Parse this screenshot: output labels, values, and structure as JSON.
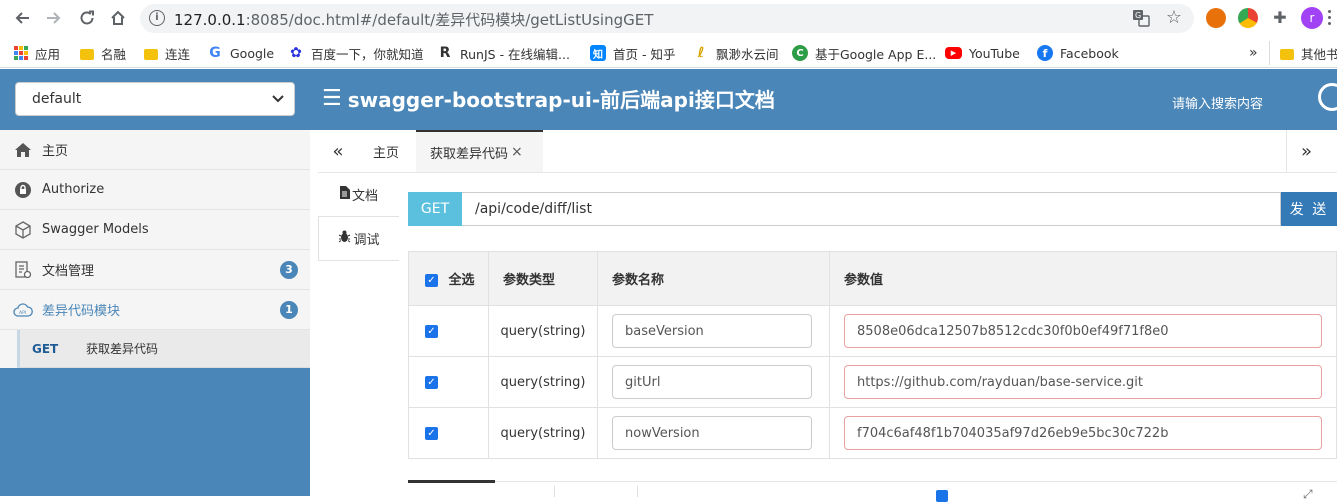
{
  "browser": {
    "url_host": "127.0.0.1",
    "url_rest": ":8085/doc.html#/default/差异代码模块/getListUsingGET",
    "avatar_letter": "r",
    "bookmarks": [
      {
        "label": "应用",
        "icon": "apps-icon"
      },
      {
        "label": "名融",
        "icon": "folder-icon"
      },
      {
        "label": "连连",
        "icon": "folder-icon"
      },
      {
        "label": "Google",
        "icon": "google-icon"
      },
      {
        "label": "百度一下，你就知道",
        "icon": "baidu-icon"
      },
      {
        "label": "RunJS - 在线编辑...",
        "icon": "runjs-icon"
      },
      {
        "label": "首页 - 知乎",
        "icon": "zhihu-icon"
      },
      {
        "label": "飘渺水云间",
        "icon": "wave-icon"
      },
      {
        "label": "基于Google App E...",
        "icon": "green-c-icon"
      },
      {
        "label": "YouTube",
        "icon": "youtube-icon"
      },
      {
        "label": "Facebook",
        "icon": "facebook-icon"
      }
    ],
    "overflow": "»",
    "other_bookmarks": "其他书"
  },
  "header": {
    "group_select_value": "default",
    "title": "swagger-bootstrap-ui-前后端api接口文档",
    "search_placeholder": "请输入搜索内容"
  },
  "sidebar": {
    "items": [
      {
        "label": "主页",
        "icon": "home-icon"
      },
      {
        "label": "Authorize",
        "icon": "lock-icon"
      },
      {
        "label": "Swagger Models",
        "icon": "cube-icon"
      },
      {
        "label": "文档管理",
        "icon": "doc-manage-icon",
        "badge": "3"
      },
      {
        "label": "差异代码模块",
        "icon": "cloud-api-icon",
        "badge": "1"
      }
    ],
    "sub_item": {
      "method": "GET",
      "label": "获取差异代码"
    }
  },
  "tabs": {
    "prev": "«",
    "next": "»",
    "items": [
      {
        "label": "主页"
      },
      {
        "label": "获取差异代码",
        "close": "×"
      }
    ]
  },
  "vtabs": {
    "doc": "文档",
    "debug": "调试"
  },
  "request": {
    "method": "GET",
    "url": "/api/code/diff/list",
    "send": "发 送"
  },
  "params": {
    "headers": {
      "select_all": "全选",
      "type": "参数类型",
      "name": "参数名称",
      "value": "参数值"
    },
    "rows": [
      {
        "type": "query(string)",
        "name": "baseVersion",
        "value": "8508e06dca12507b8512cdc30f0b0ef49f71f8e0"
      },
      {
        "type": "query(string)",
        "name": "gitUrl",
        "value": "https://github.com/rayduan/base-service.git"
      },
      {
        "type": "query(string)",
        "name": "nowVersion",
        "value": "f704c6af48f1b704035af97d26eb9e5bc30c722b"
      }
    ]
  },
  "colors": {
    "header_bg": "#4a86b7",
    "method_get": "#5bc0de",
    "send_btn": "#337ab7",
    "checkbox": "#1a73e8"
  }
}
